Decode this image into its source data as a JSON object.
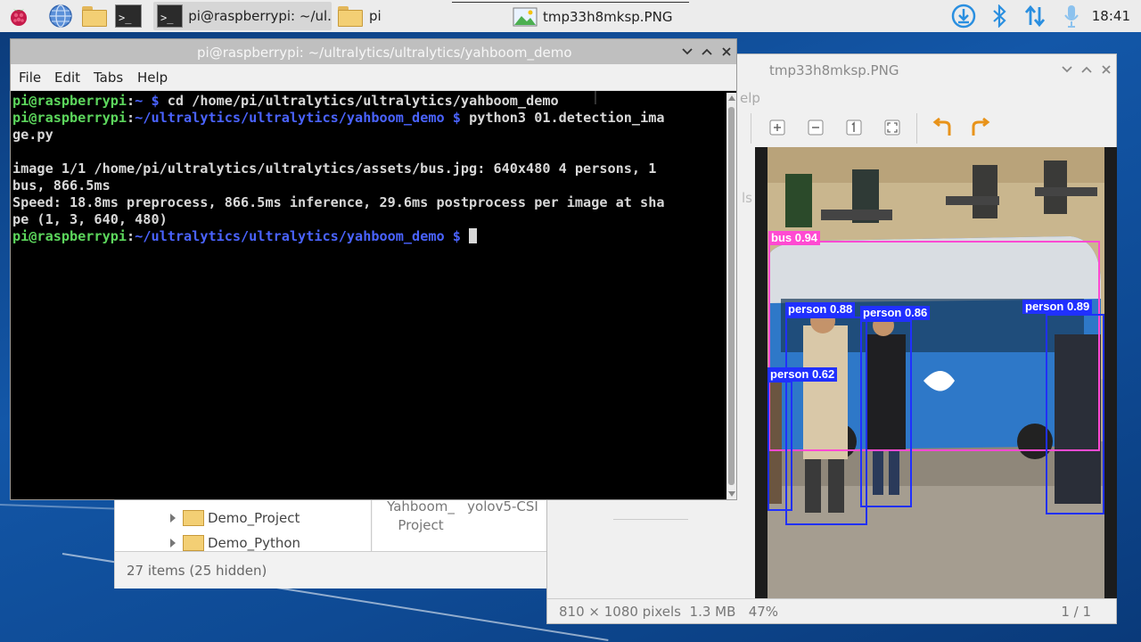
{
  "taskbar": {
    "tasks": [
      {
        "label": "pi@raspberrypi: ~/ul..",
        "active": true
      },
      {
        "label": "pi",
        "active": false
      },
      {
        "label": "tmp33h8mksp.PNG",
        "active": false
      }
    ],
    "clock": "18:41"
  },
  "terminal": {
    "title": "pi@raspberrypi: ~/ultralytics/ultralytics/yahboom_demo",
    "menu": [
      "File",
      "Edit",
      "Tabs",
      "Help"
    ],
    "lines": [
      [
        {
          "t": "pi@raspberrypi",
          "c": "user"
        },
        {
          "t": ":",
          "c": "txt"
        },
        {
          "t": "~ $ ",
          "c": "path"
        },
        {
          "t": "cd /home/pi/ultralytics/ultralytics/yahboom_demo",
          "c": "txt"
        }
      ],
      [
        {
          "t": "pi@raspberrypi",
          "c": "user"
        },
        {
          "t": ":",
          "c": "txt"
        },
        {
          "t": "~/ultralytics/ultralytics/yahboom_demo $ ",
          "c": "path"
        },
        {
          "t": "python3 01.detection_ima",
          "c": "txt"
        }
      ],
      [
        {
          "t": "ge.py",
          "c": "txt"
        }
      ],
      [
        {
          "t": "",
          "c": "txt"
        }
      ],
      [
        {
          "t": "image 1/1 /home/pi/ultralytics/ultralytics/assets/bus.jpg: 640x480 4 persons, 1",
          "c": "txt"
        }
      ],
      [
        {
          "t": "bus, 866.5ms",
          "c": "txt"
        }
      ],
      [
        {
          "t": "Speed: 18.8ms preprocess, 866.5ms inference, 29.6ms postprocess per image at sha",
          "c": "txt"
        }
      ],
      [
        {
          "t": "pe (1, 3, 640, 480)",
          "c": "txt"
        }
      ],
      [
        {
          "t": "pi@raspberrypi",
          "c": "user"
        },
        {
          "t": ":",
          "c": "txt"
        },
        {
          "t": "~/ultralytics/ultralytics/yahboom_demo $ ",
          "c": "path"
        }
      ]
    ]
  },
  "viewer": {
    "title": "tmp33h8mksp.PNG",
    "menu_ghost": "elp",
    "side_ghost": "ls",
    "status_left": "810 × 1080 pixels  1.3 MB   47%",
    "status_right": "1 / 1",
    "detections": [
      {
        "label": "bus 0.94"
      },
      {
        "label": "person 0.88"
      },
      {
        "label": "person 0.86"
      },
      {
        "label": "person 0.89"
      },
      {
        "label": "person 0.62"
      }
    ],
    "colors": {
      "bus": "#ff4ad2",
      "person": "#2030ff"
    }
  },
  "file_manager": {
    "tree": [
      "Demo_Project",
      "Demo_Python"
    ],
    "icons": [
      "Yahboom_\nProject",
      "yolov5-CSI"
    ],
    "status": "27 items (25 hidden)"
  }
}
